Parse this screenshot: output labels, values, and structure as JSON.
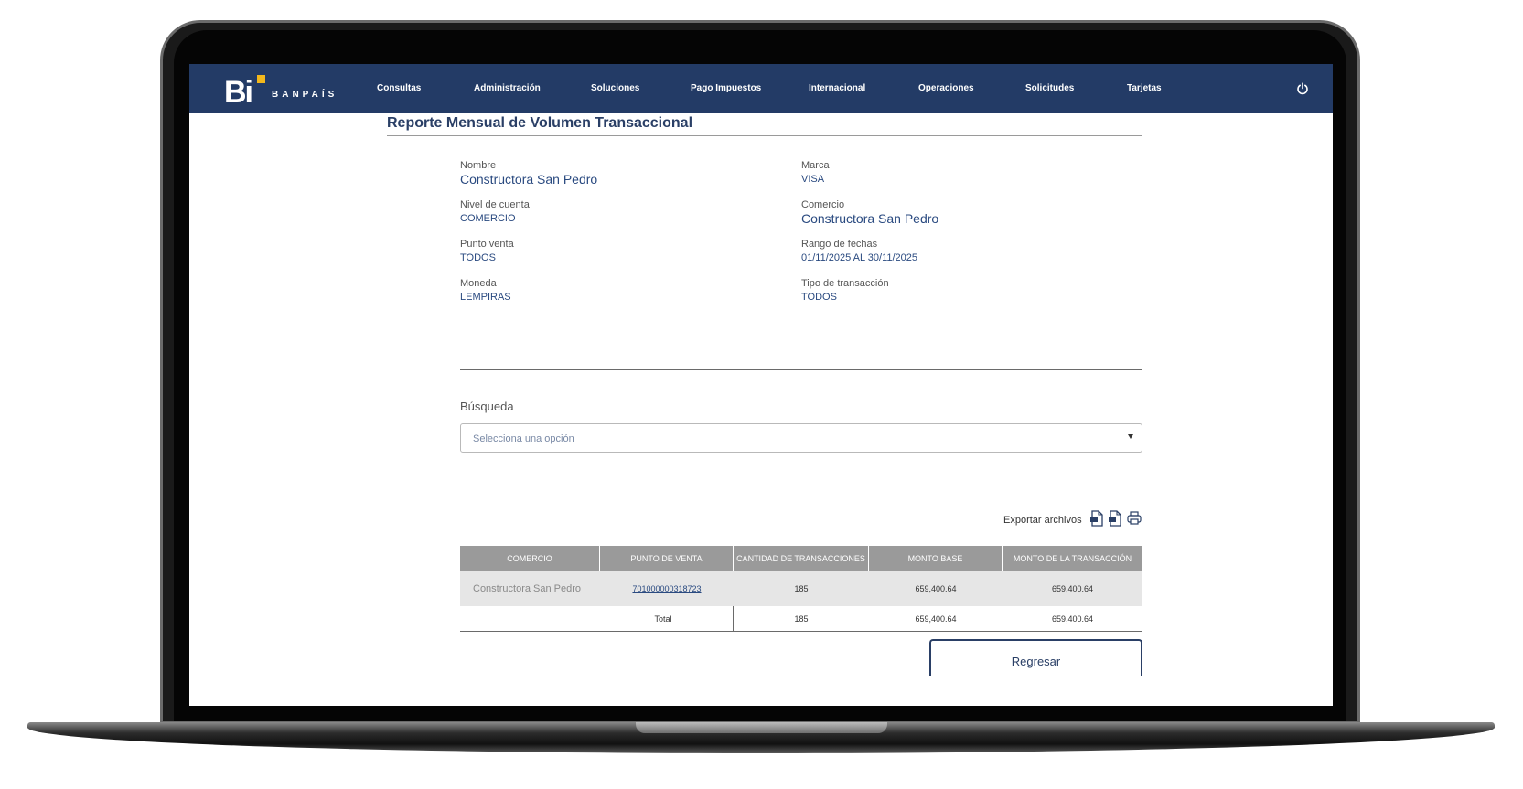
{
  "nav": {
    "brand": "BANPAÍS",
    "logo_mark": "Bi",
    "items": [
      "Consultas",
      "Administración",
      "Soluciones",
      "Pago Impuestos",
      "Internacional",
      "Operaciones",
      "Solicitudes",
      "Tarjetas"
    ],
    "power_icon": "power-icon"
  },
  "page": {
    "title": "Reporte Mensual de Volumen Transaccional"
  },
  "info": {
    "nombre": {
      "label": "Nombre",
      "value": "Constructora San Pedro"
    },
    "marca": {
      "label": "Marca",
      "value": "VISA"
    },
    "nivel": {
      "label": "Nivel de cuenta",
      "value": "COMERCIO"
    },
    "comercio": {
      "label": "Comercio",
      "value": "Constructora San Pedro"
    },
    "punto": {
      "label": "Punto venta",
      "value": "TODOS"
    },
    "rango": {
      "label": "Rango de fechas",
      "value": "01/11/2025 AL 30/11/2025"
    },
    "moneda": {
      "label": "Moneda",
      "value": "LEMPIRAS"
    },
    "tipo": {
      "label": "Tipo de transacción",
      "value": "TODOS"
    }
  },
  "search": {
    "label": "Búsqueda",
    "placeholder": "Selecciona una opción"
  },
  "export": {
    "label": "Exportar archivos",
    "icons": [
      "excel-file-icon",
      "pdf-file-icon",
      "print-icon"
    ]
  },
  "table": {
    "headers": [
      "COMERCIO",
      "PUNTO DE VENTA",
      "CANTIDAD DE TRANSACCIONES",
      "MONTO BASE",
      "MONTO DE LA TRANSACCIÓN"
    ],
    "row": {
      "comercio": "Constructora San Pedro",
      "punto": "701000000318723",
      "cantidad": "185",
      "monto_base": "659,400.64",
      "monto_transaccion": "659,400.64"
    },
    "total": {
      "label": "Total",
      "cantidad": "185",
      "monto_base": "659,400.64",
      "monto_transaccion": "659,400.64"
    }
  },
  "actions": {
    "back": "Regresar"
  },
  "colors": {
    "navbar": "#233b66",
    "accent": "#f3b81c",
    "text_value": "#2a4a80",
    "table_header": "#9a9a9a"
  }
}
